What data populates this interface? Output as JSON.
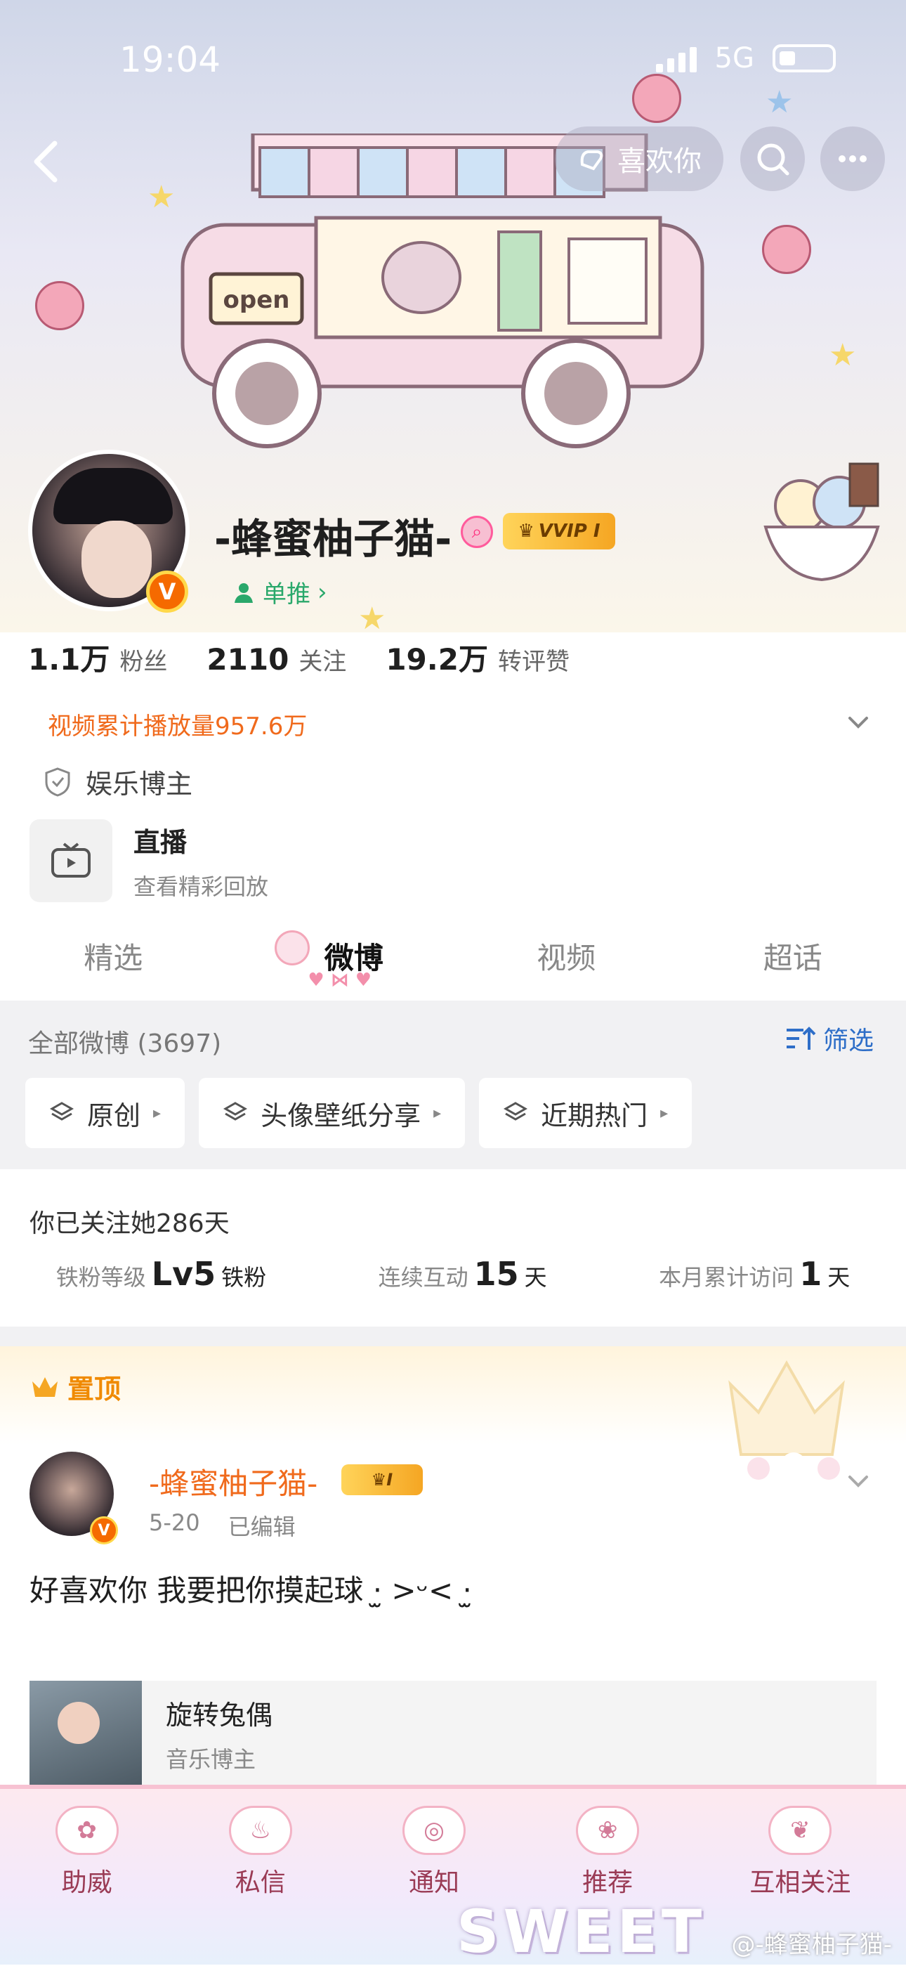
{
  "status_bar": {
    "time": "19:04",
    "network": "5G"
  },
  "header": {
    "like_button_label": "喜欢你"
  },
  "profile": {
    "name": "-蜂蜜柚子猫-",
    "vip_badge": "VVIP I",
    "verify_mark": "V",
    "single_push": "单推",
    "stats": [
      {
        "number": "1.1万",
        "label": "粉丝"
      },
      {
        "number": "2110",
        "label": "关注"
      },
      {
        "number": "19.2万",
        "label": "转评赞"
      }
    ],
    "video_play_count": "视频累计播放量957.6万",
    "category_tag": "娱乐博主"
  },
  "truck_sign": "open",
  "live": {
    "title": "直播",
    "subtitle": "查看精彩回放"
  },
  "tabs": [
    {
      "label": "精选"
    },
    {
      "label": "微博"
    },
    {
      "label": "视频"
    },
    {
      "label": "超话"
    }
  ],
  "feed_filter": {
    "all_posts": "全部微博 (3697)",
    "filter_label": "筛选",
    "chips": [
      {
        "label": "原创"
      },
      {
        "label": "头像壁纸分享"
      },
      {
        "label": "近期热门"
      }
    ]
  },
  "fan_info": {
    "followed_days": "你已关注她286天",
    "stats": [
      {
        "label": "铁粉等级",
        "value": "Lv5",
        "unit": "铁粉"
      },
      {
        "label": "连续互动",
        "value": "15",
        "unit": "天"
      },
      {
        "label": "本月累计访问",
        "value": "1",
        "unit": "天"
      }
    ]
  },
  "pinned": {
    "label": "置顶",
    "author": "-蜂蜜柚子猫-",
    "vip_badge": "I",
    "date": "5-20",
    "edited": "已编辑",
    "text": "好喜欢你 我要把你摸起球 ‧̫ >ᵕ< ‧̫",
    "attachment": {
      "title": "旋转兔偶",
      "subtitle": "音乐博主"
    }
  },
  "bottom_bar": {
    "items": [
      {
        "label": "助威"
      },
      {
        "label": "私信"
      },
      {
        "label": "通知"
      },
      {
        "label": "推荐"
      },
      {
        "label": "互相关注"
      }
    ],
    "decor_text": "SWEET",
    "watermark": "@-蜂蜜柚子猫-"
  },
  "colors": {
    "accent_orange": "#f06a1c",
    "link_blue": "#2e6ec8",
    "vip_gold": "#f5a623",
    "pink": "#f3a7b9"
  }
}
